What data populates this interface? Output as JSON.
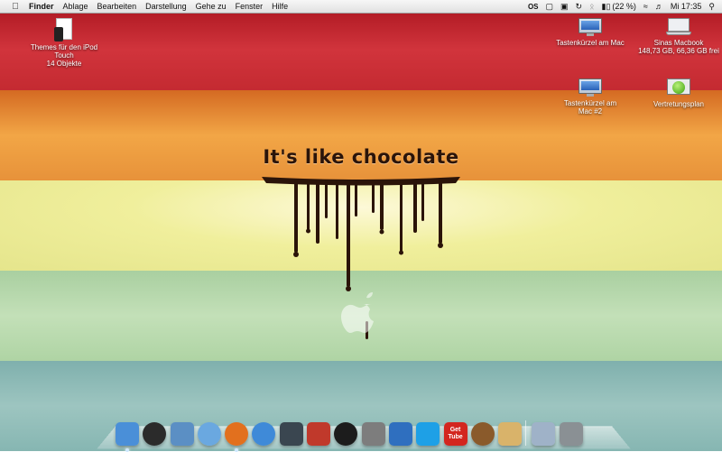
{
  "menubar": {
    "apple_icon": "apple-logo-icon",
    "items": [
      {
        "label": "Finder",
        "bold": true
      },
      {
        "label": "Ablage"
      },
      {
        "label": "Bearbeiten"
      },
      {
        "label": "Darstellung"
      },
      {
        "label": "Gehe zu"
      },
      {
        "label": "Fenster"
      },
      {
        "label": "Hilfe"
      }
    ],
    "status": {
      "battery_percent": "(22 %)",
      "clock": "Mi 17:35"
    }
  },
  "desktop": {
    "icons": [
      {
        "label": "Themes für den iPod Touch",
        "sub": "14 Objekte",
        "icon": "folder-ipod-icon"
      },
      {
        "label": "Tastenkürzel am Mac",
        "icon": "imac-icon"
      },
      {
        "label": "Sinas Macbook",
        "sub": "148,73 GB, 66,36 GB frei",
        "icon": "macbook-drive-icon"
      },
      {
        "label": "Tastenkürzel am Mac #2",
        "icon": "imac-icon"
      },
      {
        "label": "Vertretungsplan",
        "icon": "vertretungsplan-app-icon"
      }
    ]
  },
  "wallpaper": {
    "title": "It's like chocolate",
    "band_colors": [
      "#c42a31",
      "#eba042",
      "#eeed9a",
      "#bcdcb2",
      "#95bfba"
    ]
  },
  "dock": {
    "items": [
      {
        "name": "finder",
        "icon": "finder-icon",
        "color": "#4a8fd8",
        "running": true
      },
      {
        "name": "dashboard",
        "icon": "dashboard-icon",
        "color": "#2b2b2b",
        "round": true
      },
      {
        "name": "mail",
        "icon": "mail-icon",
        "color": "#5b8fc4"
      },
      {
        "name": "itunes",
        "icon": "itunes-icon",
        "color": "#6aa8e0",
        "round": true
      },
      {
        "name": "firefox",
        "icon": "firefox-icon",
        "color": "#e2701e",
        "round": true,
        "running": true
      },
      {
        "name": "safari",
        "icon": "safari-icon",
        "color": "#3f8ad8",
        "round": true
      },
      {
        "name": "iphoto",
        "icon": "iphoto-icon",
        "color": "#3a4650"
      },
      {
        "name": "wallpaper-app",
        "icon": "wallpaper-app-icon",
        "color": "#c0392b"
      },
      {
        "name": "chat",
        "icon": "chat-bubble-icon",
        "color": "#1c1c1c",
        "round": true
      },
      {
        "name": "system-preferences",
        "icon": "gear-icon",
        "color": "#7d7d7d"
      },
      {
        "name": "word",
        "icon": "word-icon",
        "color": "#2f6fbf"
      },
      {
        "name": "skype",
        "icon": "skype-icon",
        "color": "#1ea0e6"
      },
      {
        "name": "get-youtube",
        "icon": "youtube-icon",
        "color": "#d3261f",
        "text": "Get Tube"
      },
      {
        "name": "coconut-battery",
        "icon": "coconut-icon",
        "color": "#8a5a2b",
        "round": true
      },
      {
        "name": "package",
        "icon": "package-icon",
        "color": "#d9b36a"
      },
      {
        "name": "window-screenshot",
        "icon": "window-icon",
        "color": "#9fb2c8"
      },
      {
        "name": "trash",
        "icon": "trash-icon",
        "color": "#8a9094"
      }
    ]
  }
}
